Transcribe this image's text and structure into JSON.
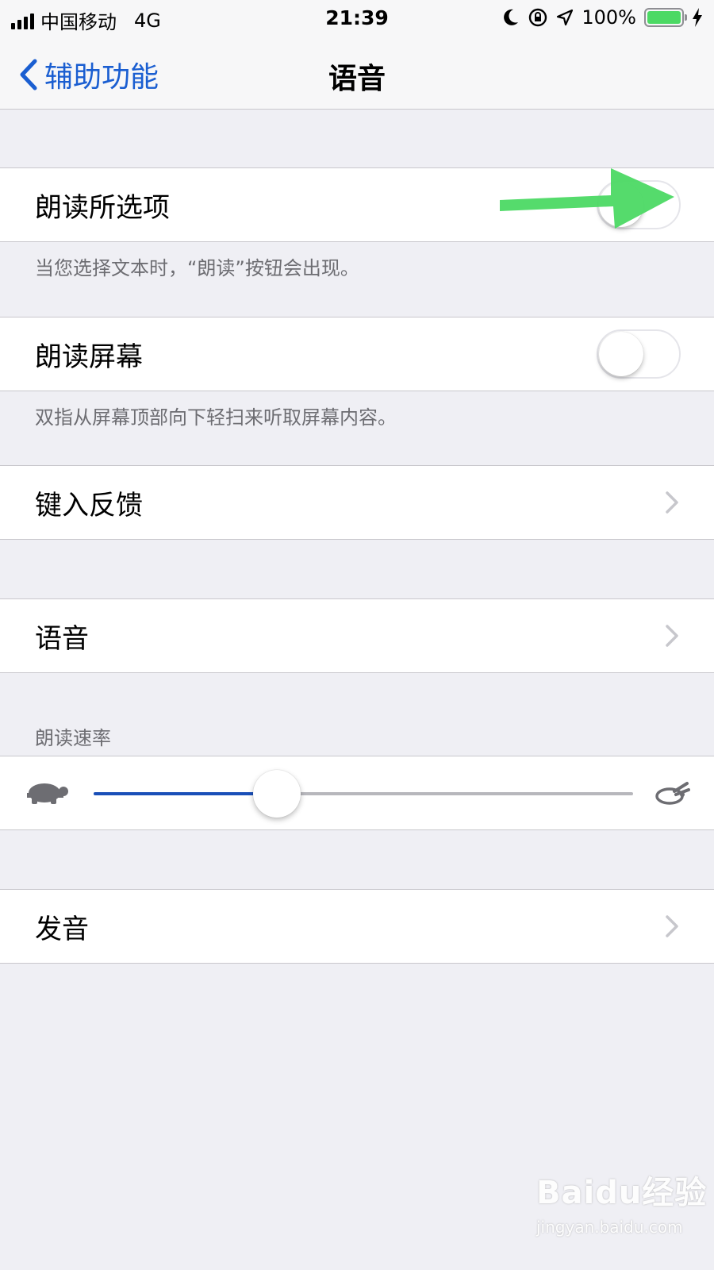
{
  "status_bar": {
    "carrier": "中国移动",
    "network": "4G",
    "time": "21:39",
    "battery": "100%",
    "battery_level": 1.0,
    "battery_color": "#4cd964"
  },
  "nav": {
    "back_label": "辅助功能",
    "title": "语音",
    "accent_color": "#1a5ed1"
  },
  "speak_selection": {
    "label": "朗读所选项",
    "enabled": false,
    "footer": "当您选择文本时，“朗读”按钮会出现。"
  },
  "speak_screen": {
    "label": "朗读屏幕",
    "enabled": false,
    "footer": "双指从屏幕顶部向下轻扫来听取屏幕内容。"
  },
  "typing_feedback": {
    "label": "键入反馈"
  },
  "voices": {
    "label": "语音"
  },
  "speaking_rate": {
    "header": "朗读速率",
    "value": 0.34,
    "slow_icon": "turtle-icon",
    "fast_icon": "rabbit-icon"
  },
  "pronunciations": {
    "label": "发音"
  },
  "annotation": {
    "type": "green-arrow",
    "color": "#4cd964"
  },
  "watermark": {
    "logo": "Baidu经验",
    "sub": "jingyan.baidu.com"
  }
}
